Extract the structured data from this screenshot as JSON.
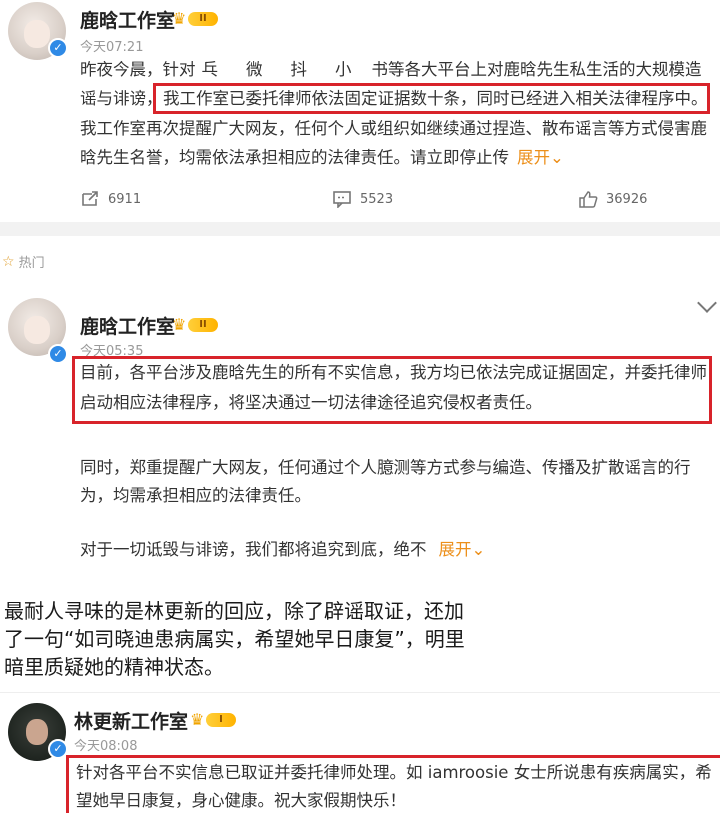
{
  "post1": {
    "author": "鹿晗工作室",
    "vip_level": "II",
    "time": "今天07:21",
    "lines": [
      "昨夜今晨，针对",
      "谣与诽谤，",
      "我工作室已委托律师依法固定证据数十条，同时已经进入相关法律程序中。",
      "我工作室再次提醒广大网友，任何个人或组织如继续通过捏造、散布谣言等方式侵害鹿",
      "晗先生名誉，均需依法承担相应的法律责任。请立即停止传"
    ],
    "line1_fragments": [
      "乓",
      "微",
      "抖",
      "小",
      "书等各大平台上对鹿晗先生私生活的大规模造"
    ],
    "expand": "展开",
    "repost_count": "6911",
    "comment_count": "5523",
    "like_count": "36926"
  },
  "hot_label": "热门",
  "post2": {
    "author": "鹿晗工作室",
    "vip_level": "II",
    "time": "今天05:35",
    "boxed_lines": [
      "目前，各平台涉及鹿晗先生的所有不实信息，我方均已依法完成证据固定，并委托律师",
      "启动相应法律程序，将坚决通过一切法律途径追究侵权者责任。"
    ],
    "lines": [
      "同时，郑重提醒广大网友，任何通过个人臆测等方式参与编造、传播及扩散谣言的行",
      "为，均需承担相应的法律责任。"
    ],
    "last_line": "对于一切诋毁与诽谤，我们都将追究到底，绝不",
    "expand": "展开"
  },
  "article_lines": [
    "最耐人寻味的是林更新的回应，除了辟谣取证，还加",
    "了一句“如司晓迪患病属实，希望她早日康复”，明里",
    "暗里质疑她的精神状态。"
  ],
  "post3": {
    "author": "林更新工作室",
    "vip_level": "I",
    "time": "今天08:08",
    "lines": [
      "针对各平台不实信息已取证并委托律师处理。如 iamroosie 女士所说患有疾病属实，希",
      "望她早日康复，身心健康。祝大家假期快乐！"
    ]
  },
  "colors": {
    "highlight_box": "#d8232a",
    "expand": "#ec8f1a",
    "verify": "#2f8ae6"
  }
}
